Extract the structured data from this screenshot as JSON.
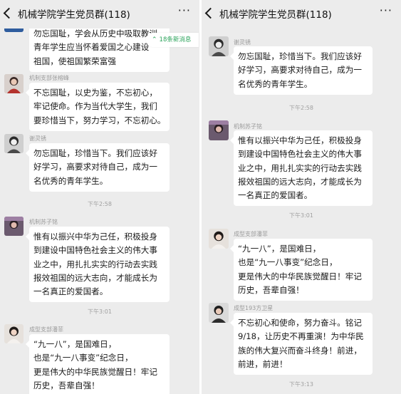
{
  "left_panel": {
    "header": {
      "title": "机械学院学生党员群(118)",
      "more": "···"
    },
    "unread_pill": {
      "arrow": "⌃",
      "text": "18条新消息"
    },
    "messages": [
      {
        "text": "勿忘国耻，学会从历史中吸取教训，\n青年学生应当怀着爱国之心建设\n祖国，使祖国繁荣富强"
      },
      {
        "sender": "机制支部张榕峰",
        "text": "不忘国耻，以史为鉴，不忘初心，\n牢记使命。作为当代大学生，我们\n要珍惜当下，努力学习，不忘初心。"
      },
      {
        "sender": "谢灵锈",
        "text": "勿忘国耻，珍惜当下。我们应该好\n好学习，高要求对待自己，成为一\n名优秀的青年学生。"
      },
      {
        "sender": "机制苏子铭",
        "text": "惟有以振兴中华为己任，积极投身\n到建设中国特色社会主义的伟大事\n业之中，用扎扎实实的行动去实践\n报效祖国的远大志向，才能成长为\n一名真正的爱国者。"
      },
      {
        "sender": "成型支部潘菲",
        "text": "“九一八”，是国难日，\n也是“九一八事变”纪念日，\n更是伟大的中华民族觉醒日！牢记\n历史，吾辈自强！"
      }
    ],
    "times": [
      "下午2:58",
      "下午3:01"
    ]
  },
  "right_panel": {
    "header": {
      "title": "机械学院学生党员群(118)",
      "more": "···"
    },
    "messages": [
      {
        "sender": "谢灵锈",
        "text": "勿忘国耻，珍惜当下。我们应该好\n好学习，高要求对待自己，成为一\n名优秀的青年学生。"
      },
      {
        "sender": "机制苏子铭",
        "text": "惟有以振兴中华为己任，积极投身\n到建设中国特色社会主义的伟大事\n业之中，用扎扎实实的行动去实践\n报效祖国的远大志向，才能成长为\n一名真正的爱国者。"
      },
      {
        "sender": "成型支部潘菲",
        "text": "“九一八”，是国难日，\n也是“九一八事变”纪念日，\n更是伟大的中华民族觉醒日！牢记\n历史，吾辈自强！"
      },
      {
        "sender": "成型193方卫星",
        "text": "不忘初心和使命，努力奋斗。铭记\n9/18，让历史不再重演！为中华民\n族的伟大复兴而奋斗终身！前进，\n前进，前进！"
      }
    ],
    "times": [
      "下午2:58",
      "下午3:01",
      "下午3:13"
    ]
  }
}
